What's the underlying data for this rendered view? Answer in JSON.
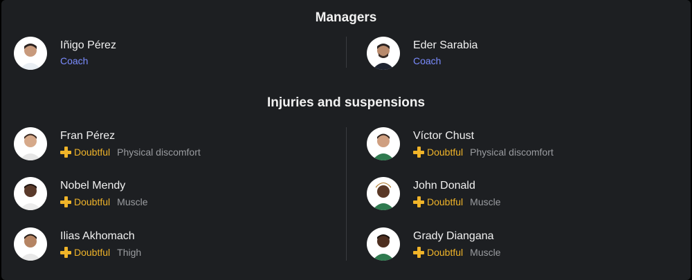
{
  "managers": {
    "title": "Managers",
    "items": [
      {
        "name": "Iñigo Pérez",
        "role": "Coach"
      },
      {
        "name": "Eder Sarabia",
        "role": "Coach"
      }
    ]
  },
  "injuries": {
    "title": "Injuries and suspensions",
    "left": [
      {
        "name": "Fran Pérez",
        "status": "Doubtful",
        "reason": "Physical discomfort"
      },
      {
        "name": "Nobel Mendy",
        "status": "Doubtful",
        "reason": "Muscle"
      },
      {
        "name": "Ilias Akhomach",
        "status": "Doubtful",
        "reason": "Thigh"
      }
    ],
    "right": [
      {
        "name": "Víctor Chust",
        "status": "Doubtful",
        "reason": "Physical discomfort"
      },
      {
        "name": "John Donald",
        "status": "Doubtful",
        "reason": "Muscle"
      },
      {
        "name": "Grady Diangana",
        "status": "Doubtful",
        "reason": "Muscle"
      }
    ]
  },
  "colors": {
    "background": "#1d1f22",
    "coach_role": "#7b8cff",
    "doubtful": "#f0b429",
    "reason": "#9a9ca0"
  },
  "icons": {
    "doubtful": "plus-icon",
    "player": "player-avatar"
  }
}
